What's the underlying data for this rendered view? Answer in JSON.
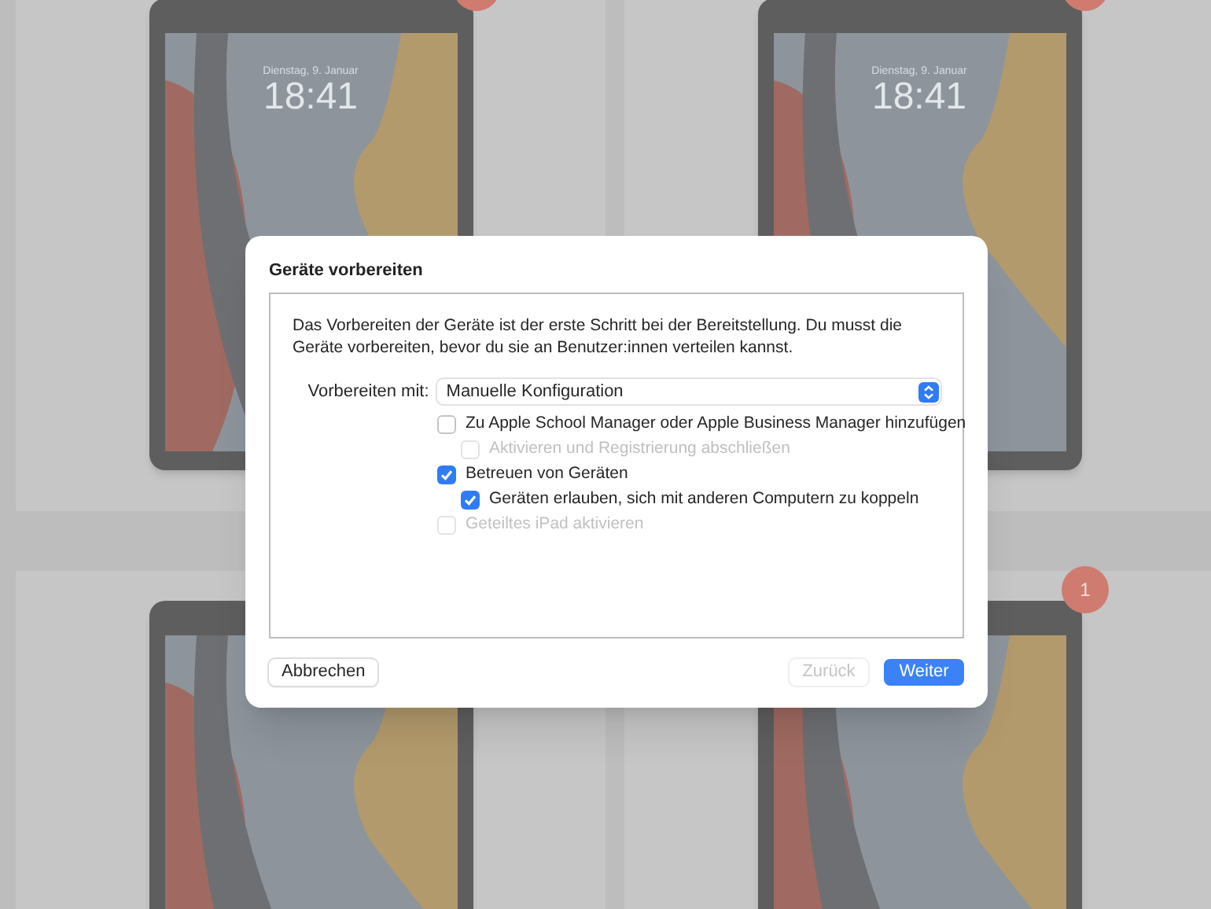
{
  "devices": [
    {
      "date": "Dienstag, 9. Januar",
      "time": "18:41",
      "badge": true
    },
    {
      "date": "Dienstag, 9. Januar",
      "time": "18:41",
      "badge": true
    },
    {
      "badge": false
    },
    {
      "badge": true,
      "badge_count": "1"
    }
  ],
  "dialog": {
    "title": "Geräte vorbereiten",
    "description": "Das Vorbereiten der Geräte ist der erste Schritt bei der Bereitstellung. Du musst die Geräte vorbereiten, bevor du sie an Benutzer:innen verteilen kannst.",
    "prepare_with": {
      "label": "Vorbereiten mit:",
      "value": "Manuelle Konfiguration"
    },
    "options": [
      {
        "label": "Zu Apple School Manager oder Apple Business Manager hinzufügen",
        "checked": false,
        "disabled": false,
        "children": [
          {
            "label": "Aktivieren und Registrierung abschließen",
            "checked": false,
            "disabled": true
          }
        ]
      },
      {
        "label": "Betreuen von Geräten",
        "checked": true,
        "disabled": false,
        "children": [
          {
            "label": "Geräten erlauben, sich mit anderen Computern zu koppeln",
            "checked": true,
            "disabled": false
          }
        ]
      },
      {
        "label": "Geteiltes iPad aktivieren",
        "checked": false,
        "disabled": true
      }
    ],
    "buttons": [
      {
        "label": "Abbrechen",
        "kind": "secondary",
        "disabled": false
      },
      {
        "label": "Zurück",
        "kind": "secondary",
        "disabled": true
      },
      {
        "label": "Weiter",
        "kind": "primary",
        "disabled": false
      }
    ]
  }
}
